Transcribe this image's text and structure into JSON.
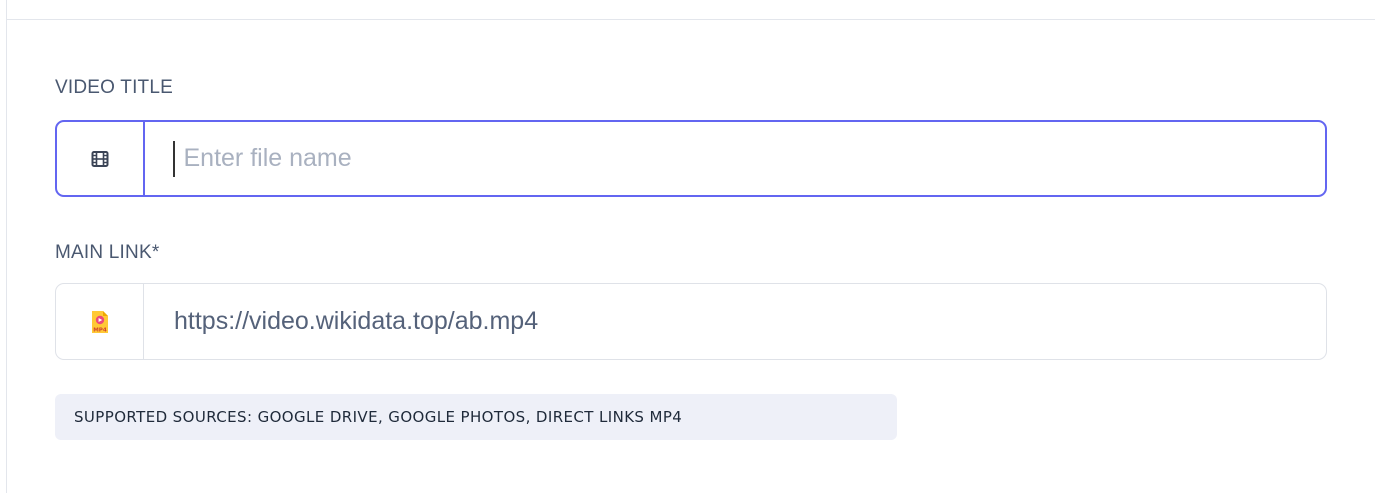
{
  "form": {
    "video_title": {
      "label": "VIDEO TITLE",
      "placeholder": "Enter file name",
      "value": "",
      "icon": "film-icon"
    },
    "main_link": {
      "label": "MAIN LINK*",
      "value": "https://video.wikidata.top/ab.mp4",
      "icon": "mp4-file-icon"
    },
    "supported_sources": "SUPPORTED SOURCES: GOOGLE DRIVE, GOOGLE PHOTOS, DIRECT LINKS MP4"
  },
  "colors": {
    "focus_border": "#6366f1",
    "label_text": "#4a5870",
    "badge_bg": "#eef0f8"
  }
}
